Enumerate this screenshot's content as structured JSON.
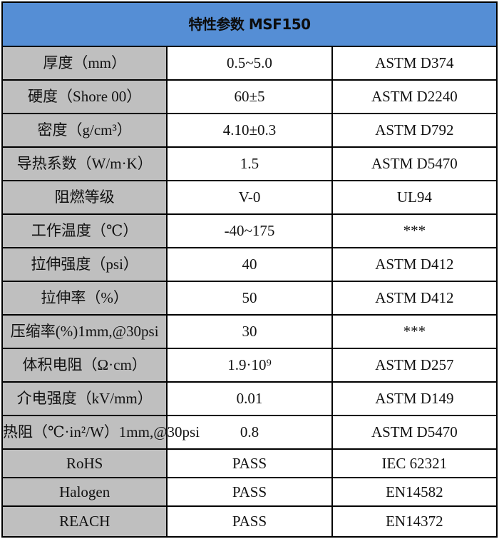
{
  "table": {
    "title": "特性参数 MSF150",
    "colors": {
      "header_bg": "#558ED5",
      "label_bg": "#BFBFBF",
      "value_bg": "#FFFFFF",
      "border": "#000000"
    },
    "rows": [
      {
        "property": "厚度（mm）",
        "value": "0.5~5.0",
        "standard": "ASTM D374"
      },
      {
        "property": "硬度（Shore 00）",
        "value": "60±5",
        "standard": "ASTM D2240"
      },
      {
        "property": "密度（g/cm³）",
        "value": "4.10±0.3",
        "standard": "ASTM D792"
      },
      {
        "property": "导热系数（W/m·K）",
        "value": "1.5",
        "standard": "ASTM D5470"
      },
      {
        "property": "阻燃等级",
        "value": "V-0",
        "standard": "UL94"
      },
      {
        "property": "工作温度（℃）",
        "value": "-40~175",
        "standard": "***"
      },
      {
        "property": "拉伸强度（psi）",
        "value": "40",
        "standard": "ASTM D412"
      },
      {
        "property": "拉伸率（%）",
        "value": "50",
        "standard": "ASTM D412"
      },
      {
        "property": "压缩率(%)1mm,@30psi",
        "value": "30",
        "standard": "***"
      },
      {
        "property": "体积电阻（Ω·cm）",
        "value": "1.9·10⁹",
        "standard": "ASTM D257"
      },
      {
        "property": "介电强度（kV/mm）",
        "value": "0.01",
        "standard": "ASTM D149"
      },
      {
        "property": "热阻（℃·in²/W）1mm,@30psi",
        "value": "0.8",
        "standard": "ASTM D5470"
      },
      {
        "property": "RoHS",
        "value": "PASS",
        "standard": "IEC 62321"
      },
      {
        "property": "Halogen",
        "value": "PASS",
        "standard": "EN14582"
      },
      {
        "property": "REACH",
        "value": "PASS",
        "standard": "EN14372"
      }
    ]
  }
}
